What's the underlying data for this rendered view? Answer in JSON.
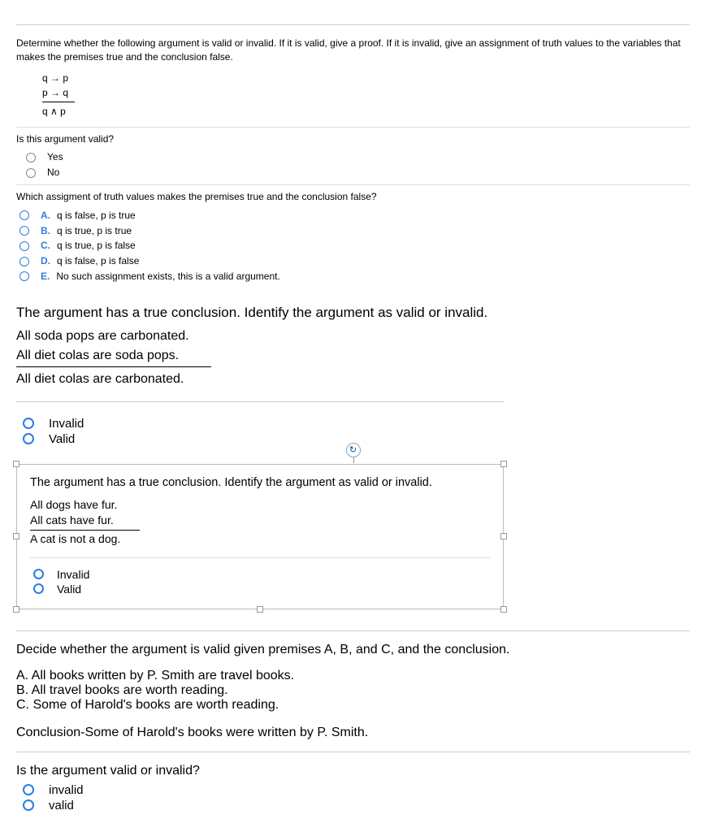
{
  "q1": {
    "prompt": "Determine whether the following argument is valid or invalid. If it is valid, give a proof. If it is invalid, give an assignment of truth values to the variables that makes the premises true and the conclusion false.",
    "premise1": "q → p",
    "premise2": "p → q",
    "conclusion": "q ∧ p",
    "sub1": "Is this argument valid?",
    "opt_yes": "Yes",
    "opt_no": "No",
    "sub2": "Which assigment of truth values makes the premises true and the conclusion false?",
    "A": "q is false, p is true",
    "B": "q is true, p is true",
    "C": "q is true, p is false",
    "D": "q is false, p is false",
    "E": "No such assignment exists, this is a valid argument."
  },
  "q2": {
    "prompt": "The argument has a true conclusion. Identify the argument as valid or invalid.",
    "p1": "All soda pops are carbonated.",
    "p2": "All diet colas are soda pops.",
    "c": "All diet colas are carbonated.",
    "opt_invalid": "Invalid",
    "opt_valid": "Valid"
  },
  "q3": {
    "prompt": "The argument has a true conclusion. Identify the argument as valid or invalid.",
    "p1": "All dogs have fur.",
    "p2": "All cats have fur.",
    "c": "A cat is not a dog.",
    "opt_invalid": "Invalid",
    "opt_valid": "Valid"
  },
  "q4": {
    "prompt": "Decide whether the argument is valid given premises A, B, and C, and the conclusion.",
    "A": "A. All books written by P. Smith are travel books.",
    "B": "B. All travel books are worth reading.",
    "C": "C. Some of Harold's books are worth reading.",
    "concl": "Conclusion-Some of Harold's books were written by P. Smith.",
    "sub": "Is the argument valid or invalid?",
    "opt_invalid": "invalid",
    "opt_valid": "valid"
  },
  "markers": {
    "A": "A.",
    "B": "B.",
    "C": "C.",
    "D": "D.",
    "E": "E."
  },
  "icons": {
    "rotate": "↻"
  }
}
